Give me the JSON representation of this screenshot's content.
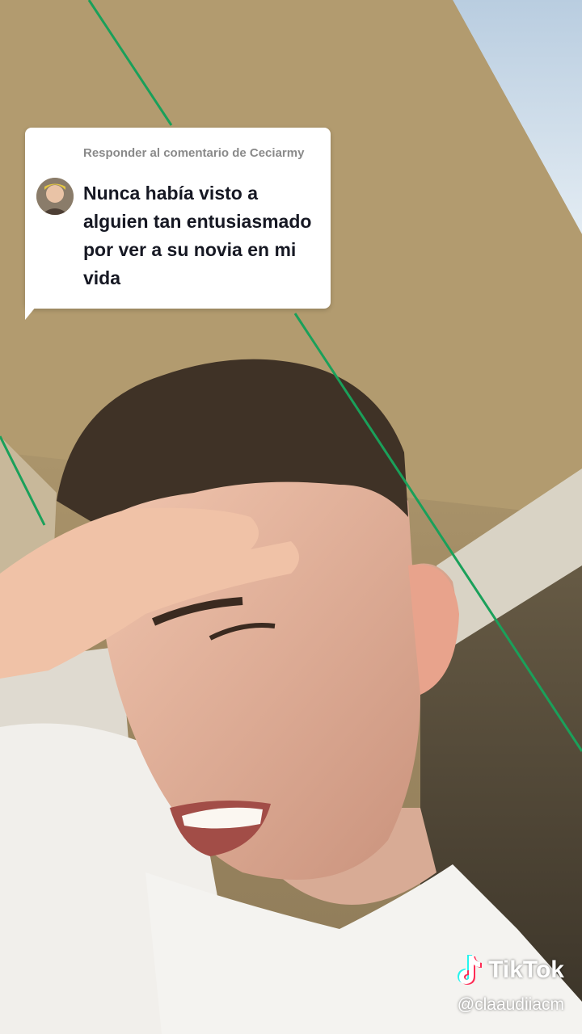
{
  "reply": {
    "header": "Responder al comentario de Ceciarmy",
    "comment": "Nunca había visto a alguien tan entusiasmado por ver a su novia en mi vida",
    "avatar_icon": "user-avatar"
  },
  "watermark": {
    "brand": "TikTok",
    "handle": "@claaudiiacm",
    "icon": "tiktok-note-icon"
  },
  "colors": {
    "bubble_bg": "#ffffff",
    "comment_text": "#161823",
    "header_text": "#8a8a8a",
    "wire": "#1aa05a",
    "wall": "#a89268"
  }
}
